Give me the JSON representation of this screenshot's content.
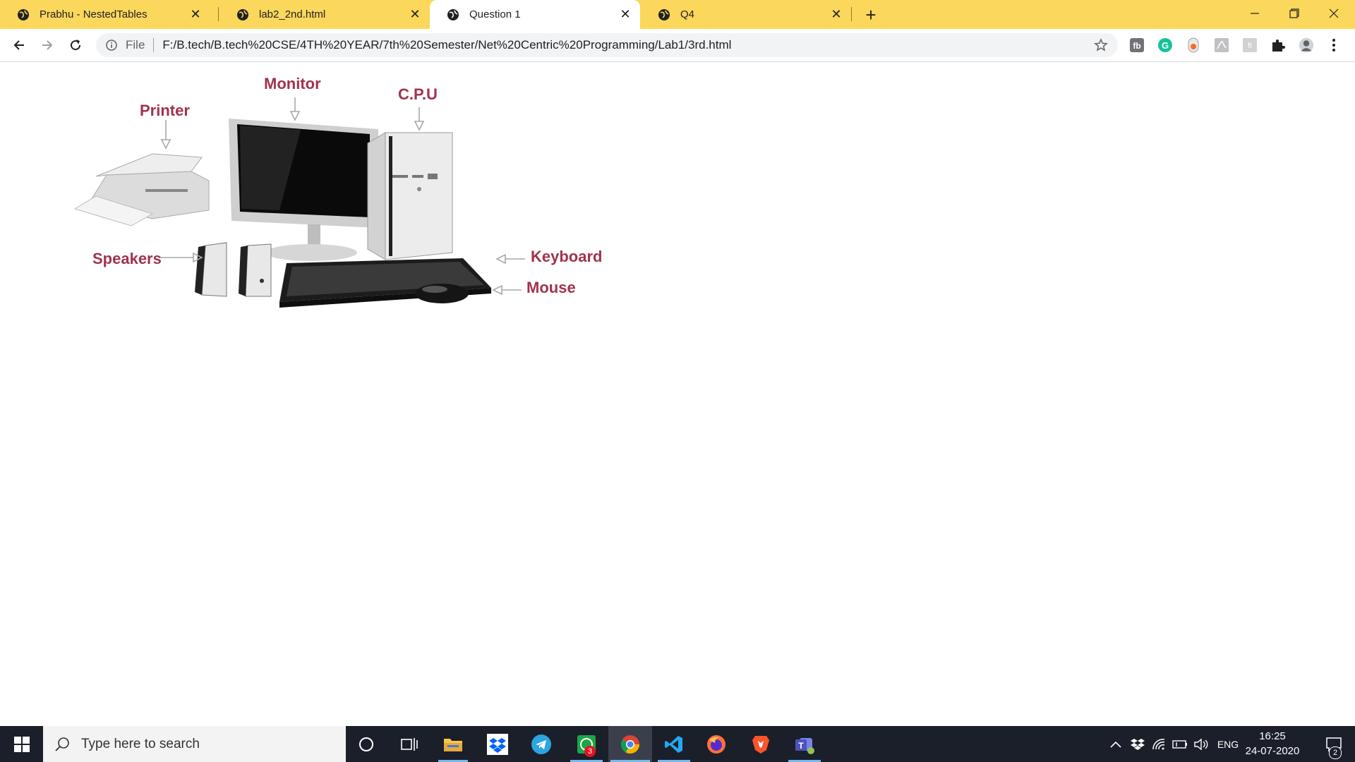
{
  "browser": {
    "tabs": [
      {
        "title": "Prabhu - NestedTables",
        "active": false
      },
      {
        "title": "lab2_2nd.html",
        "active": false
      },
      {
        "title": "Question 1",
        "active": true
      },
      {
        "title": "Q4",
        "active": false
      }
    ],
    "address": {
      "scheme_label": "File",
      "url": "F:/B.tech/B.tech%20CSE/4TH%20YEAR/7th%20Semester/Net%20Centric%20Programming/Lab1/3rd.html"
    },
    "extensions": [
      "fb-extension-icon",
      "grammarly-icon",
      "honey-icon",
      "acrobat-icon",
      "fn-extension-icon",
      "puzzle-icon",
      "profile-avatar"
    ]
  },
  "page": {
    "image_labels": {
      "monitor": "Monitor",
      "cpu": "C.P.U",
      "printer": "Printer",
      "speakers": "Speakers",
      "keyboard": "Keyboard",
      "mouse": "Mouse"
    }
  },
  "taskbar": {
    "search_placeholder": "Type here to search",
    "whatsapp_badge": "3",
    "language": "ENG",
    "time": "16:25",
    "date": "24-07-2020",
    "notification_count": "2"
  },
  "colors": {
    "tab_strip": "#fbd75b",
    "label_color": "#a0334d",
    "taskbar": "#1b1f2a"
  }
}
